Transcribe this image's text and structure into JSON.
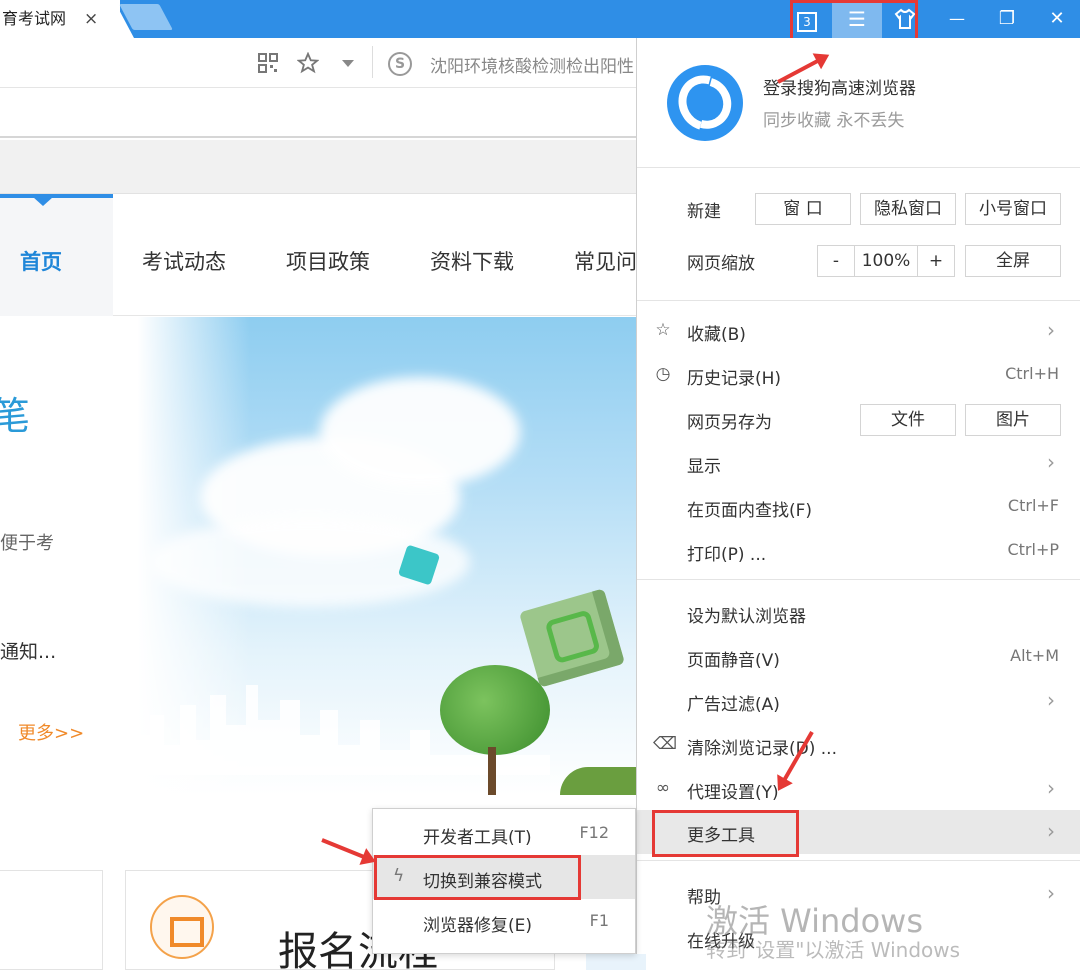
{
  "tab": {
    "title": "育考试网",
    "close": "×"
  },
  "titlebar": {
    "tab_count": "3",
    "menu_glyph": "☰",
    "skin_glyph": "👕",
    "minimize": "—",
    "restore": "❐",
    "close": "✕"
  },
  "addressbar": {
    "search_logo": "S",
    "search_text": "沈阳环境核酸检测检出阳性"
  },
  "site_nav": {
    "items": [
      "首页",
      "考试动态",
      "项目政策",
      "资料下载",
      "常见问"
    ]
  },
  "banner": {
    "headline": "笔",
    "line1": "便于考",
    "line2": "通知...",
    "more": "更多>>"
  },
  "cards": {
    "title": "报名流程"
  },
  "menu": {
    "profile": {
      "title": "登录搜狗高速浏览器",
      "subtitle": "同步收藏 永不丢失"
    },
    "new": {
      "label": "新建",
      "buttons": [
        "窗 口",
        "隐私窗口",
        "小号窗口"
      ]
    },
    "zoom": {
      "label": "网页缩放",
      "minus": "-",
      "value": "100%",
      "plus": "+",
      "fullscreen": "全屏"
    },
    "favorites": "收藏(B)",
    "history": {
      "label": "历史记录(H)",
      "shortcut": "Ctrl+H"
    },
    "save_as": {
      "label": "网页另存为",
      "file": "文件",
      "image": "图片"
    },
    "display": "显示",
    "find": {
      "label": "在页面内查找(F)",
      "shortcut": "Ctrl+F"
    },
    "print": {
      "label": "打印(P) ...",
      "shortcut": "Ctrl+P"
    },
    "default_browser": "设为默认浏览器",
    "mute": {
      "label": "页面静音(V)",
      "shortcut": "Alt+M"
    },
    "adblock": "广告过滤(A)",
    "clear": "清除浏览记录(D) ...",
    "proxy": "代理设置(Y)",
    "more_tools": "更多工具",
    "help": "帮助",
    "upgrade": "在线升级"
  },
  "submenu": {
    "devtools": {
      "label": "开发者工具(T)",
      "shortcut": "F12"
    },
    "compat": {
      "label": "切换到兼容模式"
    },
    "repair": {
      "label": "浏览器修复(E)",
      "shortcut": "F1"
    }
  },
  "watermark": {
    "line1": "激活 Windows",
    "line2": "转到\"设置\"以激活 Windows"
  },
  "colors": {
    "accent": "#2f8ee6",
    "highlight": "#e53935",
    "link_orange": "#f08a2a"
  }
}
